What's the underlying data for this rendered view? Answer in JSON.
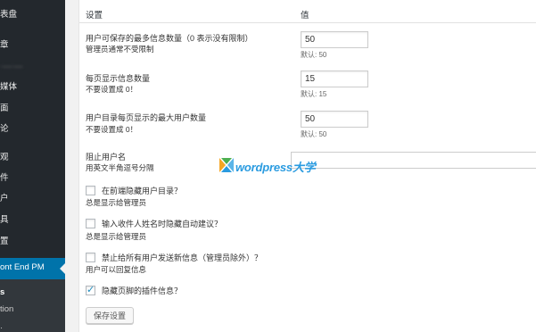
{
  "sidebar": {
    "items": [
      {
        "label": "表盘",
        "blur": false
      },
      {
        "label": "章",
        "blur": false
      },
      {
        "label": "·—·—",
        "blur": true
      },
      {
        "label": "媒体",
        "blur": false
      },
      {
        "label": "面",
        "blur": false
      },
      {
        "label": "论",
        "blur": false
      },
      {
        "label": "观",
        "blur": false
      },
      {
        "label": "件",
        "blur": false
      },
      {
        "label": "户",
        "blur": false
      },
      {
        "label": "具",
        "blur": false
      },
      {
        "label": "置",
        "blur": false
      }
    ],
    "active": "ont End PM",
    "submenu": [
      "s",
      "tion",
      "·"
    ]
  },
  "header": {
    "col_settings": "设置",
    "col_value": "值"
  },
  "rows": {
    "max_messages": {
      "label": "用户可保存的最多信息数量（0 表示没有限制）",
      "sub": "管理员通常不受限制",
      "value": "50",
      "default": "默认: 50"
    },
    "per_page": {
      "label": "每页显示信息数量",
      "sub": "不要设置成 0！",
      "value": "15",
      "default": "默认: 15"
    },
    "directory_per_page": {
      "label": "用户目录每页显示的最大用户数量",
      "sub": "不要设置成 0！",
      "value": "50",
      "default": "默认: 50"
    },
    "block_users": {
      "label": "阻止用户名",
      "sub": "用英文半角逗号分隔",
      "value": ""
    }
  },
  "checks": [
    {
      "label": "在前端隐藏用户目录？",
      "sub": "总是显示给管理员",
      "checked": false
    },
    {
      "label": "输入收件人姓名时隐藏自动建议？",
      "sub": "总是显示给管理员",
      "checked": false
    },
    {
      "label": "禁止给所有用户发送新信息（管理员除外）？",
      "sub": "用户可以回复信息",
      "checked": false
    },
    {
      "label": "隐藏页脚的插件信息？",
      "sub": "",
      "checked": true
    }
  ],
  "save_button": "保存设置",
  "watermark": {
    "text": "wordpress大学",
    "logo_colors": [
      "#f6a623",
      "#5bb5e8",
      "#4caf50"
    ]
  }
}
